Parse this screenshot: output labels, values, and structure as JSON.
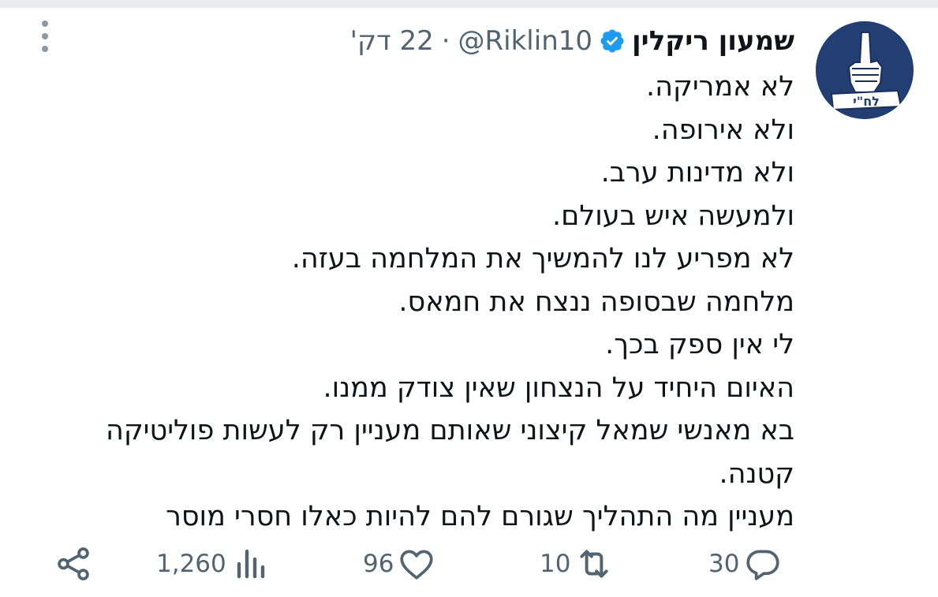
{
  "colors": {
    "verified": "#1d9bf0",
    "muted": "#536471",
    "text": "#0f1419",
    "avatar_bg": "#233e73"
  },
  "post": {
    "author_name": "שמעון ריקלין",
    "handle": "@Riklin10",
    "separator": "·",
    "time": "22 דק'",
    "verified": true,
    "avatar_text": "לח\"י",
    "lines": [
      "לא אמריקה.",
      "ולא אירופה.",
      "ולא מדינות ערב.",
      "ולמעשה איש בעולם.",
      "לא מפריע לנו להמשיך את המלחמה בעזה.",
      "מלחמה שבסופה ננצח את חמאס.",
      "לי אין ספק בכך.",
      "האיום היחיד על הנצחון שאין צודק ממנו.",
      "בא מאנשי שמאל קיצוני שאותם מעניין רק לעשות פוליטיקה",
      "קטנה.",
      "מעניין מה התהליך שגורם להם להיות כאלו חסרי מוסר"
    ]
  },
  "actions": {
    "replies": "30",
    "reposts": "10",
    "likes": "96",
    "views": "1,260"
  },
  "icons": [
    "more-vertical-icon",
    "verified-badge-icon",
    "reply-icon",
    "repost-icon",
    "like-icon",
    "views-icon",
    "share-icon"
  ]
}
